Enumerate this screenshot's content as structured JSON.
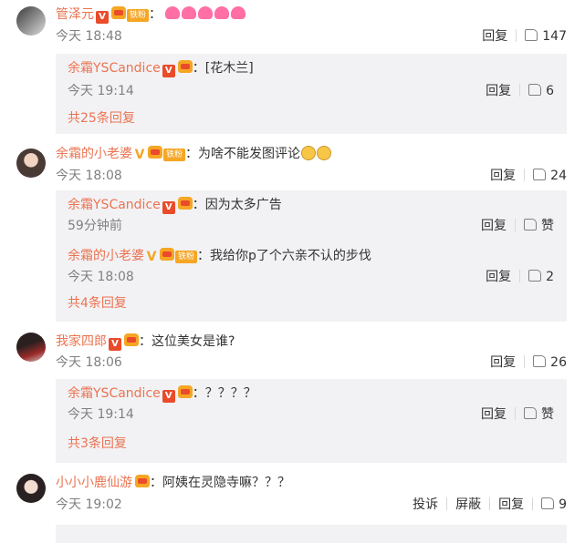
{
  "comments": [
    {
      "name": "管泽元",
      "text": "",
      "time": "今天 18:48",
      "reply": "回复",
      "likes": "147",
      "emoji_count": 5,
      "replies": [
        {
          "name": "余霜YSCandice",
          "text": "[花木兰]",
          "time": "今天 19:14",
          "reply": "回复",
          "likes": "6"
        }
      ],
      "more": "共25条回复"
    },
    {
      "name": "余霜的小老婆",
      "text": "为啥不能发图评论",
      "time": "今天 18:08",
      "reply": "回复",
      "likes": "24",
      "replies": [
        {
          "name": "余霜YSCandice",
          "text": "因为太多广告",
          "time": "59分钟前",
          "reply": "回复",
          "likes": "赞"
        },
        {
          "name": "余霜的小老婆",
          "text": "我给你p了个六亲不认的步伐",
          "time": "今天 18:08",
          "reply": "回复",
          "likes": "2"
        }
      ],
      "more": "共4条回复"
    },
    {
      "name": "我家四郎",
      "text": "这位美女是谁?",
      "time": "今天 18:06",
      "reply": "回复",
      "likes": "26",
      "replies": [
        {
          "name": "余霜YSCandice",
          "text": "？？？？",
          "time": "今天 19:14",
          "reply": "回复",
          "likes": "赞"
        }
      ],
      "more": "共3条回复"
    },
    {
      "name": "小小小鹿仙游",
      "text": "阿姨在灵隐寺嘛？？？",
      "time": "今天 19:02",
      "complain": "投诉",
      "block": "屏蔽",
      "reply": "回复",
      "likes": "9"
    }
  ],
  "fan_badge": "铁粉",
  "colors": {
    "name": "#eb7350",
    "meta": "#808080",
    "sub_bg": "#f2f2f5"
  },
  "icons": [
    "vip-v-icon",
    "crown-icon",
    "like-icon"
  ]
}
